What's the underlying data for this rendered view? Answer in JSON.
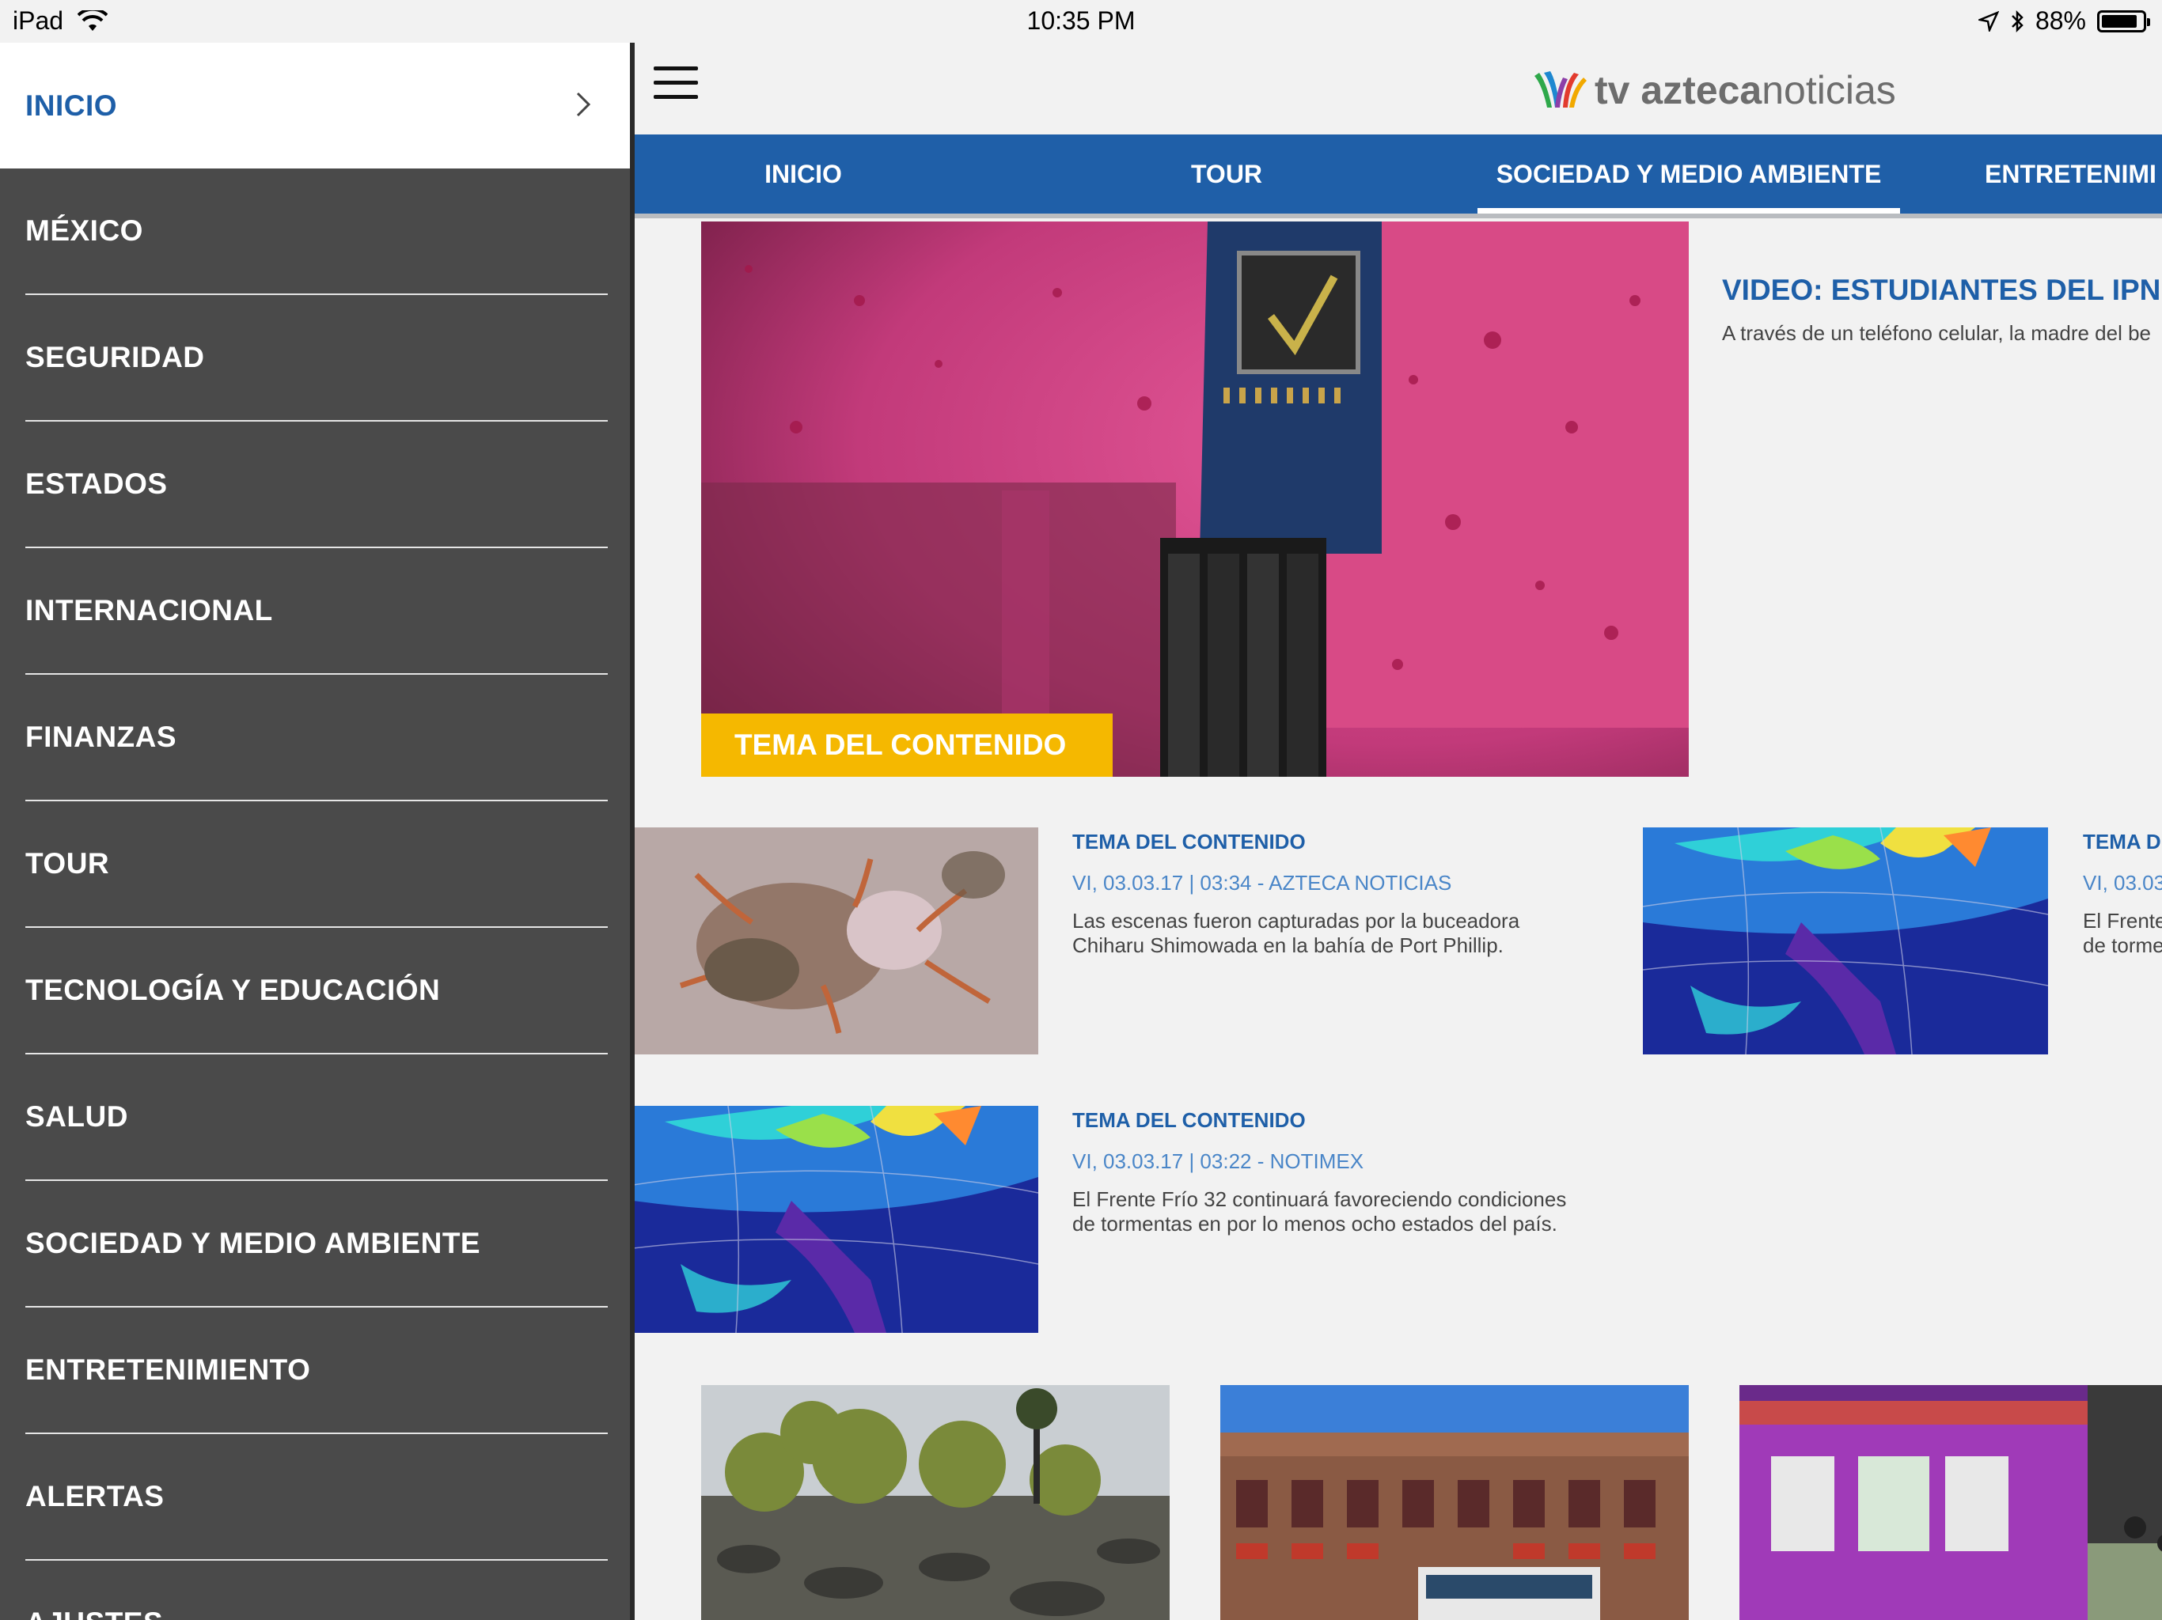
{
  "status_bar": {
    "device": "iPad",
    "time": "10:35 PM",
    "battery": "88%",
    "battery_level": 0.88
  },
  "drawer": {
    "items": [
      {
        "label": "INICIO",
        "active": true
      },
      {
        "label": "MÉXICO"
      },
      {
        "label": "SEGURIDAD"
      },
      {
        "label": "ESTADOS"
      },
      {
        "label": "INTERNACIONAL"
      },
      {
        "label": "FINANZAS"
      },
      {
        "label": "TOUR"
      },
      {
        "label": "TECNOLOGÍA Y EDUCACIÓN"
      },
      {
        "label": "SALUD"
      },
      {
        "label": "SOCIEDAD Y MEDIO AMBIENTE"
      },
      {
        "label": "ENTRETENIMIENTO"
      },
      {
        "label": "ALERTAS"
      },
      {
        "label": "AJUSTES"
      }
    ]
  },
  "header": {
    "logo_tv": "tv ",
    "logo_azteca": "azteca",
    "logo_noticias": "noticias"
  },
  "nav": {
    "tabs": [
      {
        "label": "INICIO"
      },
      {
        "label": "TOUR"
      },
      {
        "label": "SOCIEDAD Y MEDIO AMBIENTE",
        "active": true
      },
      {
        "label": "ENTRETENIMI"
      }
    ]
  },
  "hero": {
    "tag": "TEMA DEL CONTENIDO",
    "title": "VIDEO: ESTUDIANTES DEL IPN",
    "description": "A través de un teléfono celular, la madre del be"
  },
  "articles": [
    {
      "tag": "TEMA DEL CONTENIDO",
      "meta": "VI, 03.03.17  |  03:34 - AZTECA NOTICIAS",
      "desc_line1": "Las escenas fueron capturadas por la buceadora",
      "desc_line2": "Chiharu Shimowada en la bahía de Port Phillip."
    },
    {
      "tag": "TEMA D",
      "meta": "VI, 03.03",
      "desc_line1": "El Frente",
      "desc_line2": "de torme"
    },
    {
      "tag": "TEMA DEL CONTENIDO",
      "meta": "VI, 03.03.17  |  03:22 - NOTIMEX",
      "desc_line1": "El Frente Frío 32 continuará favoreciendo condiciones",
      "desc_line2": "de tormentas en por lo menos ocho estados del país."
    }
  ],
  "colors": {
    "brand_blue": "#1f5fa8",
    "tag_yellow": "#f5b800",
    "drawer_bg": "#4a4a4a"
  }
}
